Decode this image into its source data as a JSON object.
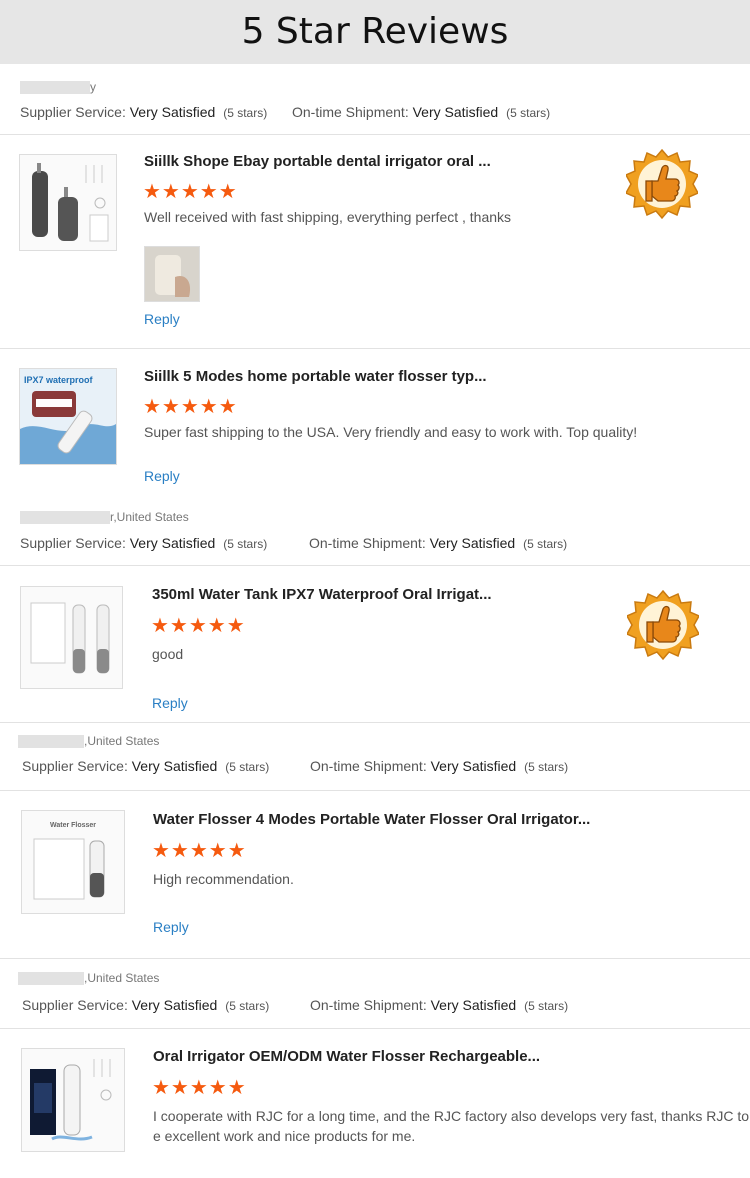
{
  "banner": {
    "title": "5 Star Reviews"
  },
  "labels": {
    "supplier_service": "Supplier Service:",
    "ontime_shipment": "On-time Shipment:",
    "very_satisfied": "Very Satisfied",
    "five_stars": "(5 stars)",
    "reply": "Reply",
    "stars": "★★★★★"
  },
  "colors": {
    "star": "#f55a0f",
    "link": "#2a7fc4",
    "badge": "#f0a020"
  },
  "buyers": [
    {
      "name": "y"
    },
    {
      "name": "r,United States"
    },
    {
      "name": ",United States"
    },
    {
      "name": ",United States"
    }
  ],
  "reviews": [
    {
      "product": "Siillk Shope Ebay portable dental irrigator oral ...",
      "rating": 5,
      "text": "Well received with fast shipping, everything perfect , thanks",
      "badge": "thumbs-up-icon",
      "thumb": "dark-water-flosser-image",
      "attachment": "buyer-photo-image"
    },
    {
      "product": "Siillk 5 Modes home portable water flosser typ...",
      "rating": 5,
      "text": "Super fast shipping to the USA. Very friendly and easy to work with. Top quality!",
      "thumb": "ipx7-waterproof-image",
      "thumb_caption": "IPX7 waterproof"
    },
    {
      "product": "350ml Water Tank IPX7 Waterproof Oral Irrigat...",
      "rating": 5,
      "text": "good",
      "badge": "thumbs-up-icon",
      "thumb": "white-flossers-box-image"
    },
    {
      "product": "Water Flosser 4 Modes Portable Water Flosser Oral Irrigator...",
      "rating": 5,
      "text": "High recommendation.",
      "thumb": "water-flosser-box-image",
      "thumb_caption": "Water Flosser"
    },
    {
      "product": "Oral Irrigator OEM/ODM Water Flosser Rechargeable...",
      "rating": 5,
      "text": "I cooperate with RJC for a long time, and the RJC factory also develops very fast, thanks RJC to s",
      "text2": "e excellent work and nice products for me.",
      "thumb": "oral-irrigator-box-image"
    }
  ]
}
